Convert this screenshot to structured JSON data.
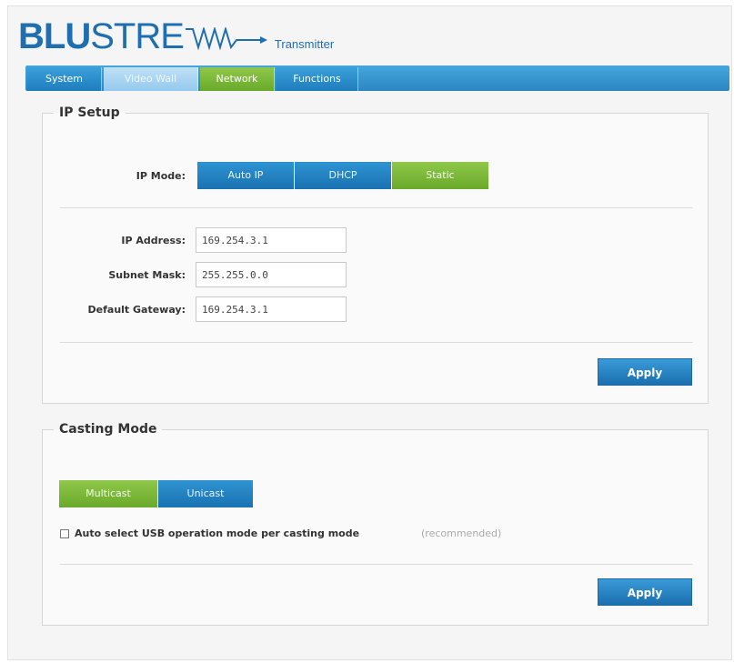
{
  "header": {
    "logo_blu": "BLU",
    "logo_stre": "STRE",
    "subtitle": "Transmitter",
    "brand_color": "#1f6fb0"
  },
  "tabs": [
    {
      "label": "System"
    },
    {
      "label": "Video Wall"
    },
    {
      "label": "Network",
      "active": true
    },
    {
      "label": "Functions"
    }
  ],
  "ip_setup": {
    "title": "IP Setup",
    "mode_label": "IP Mode:",
    "modes": [
      "Auto IP",
      "DHCP",
      "Static"
    ],
    "selected_mode": "Static",
    "ip_address_label": "IP Address:",
    "ip_address": "169.254.3.1",
    "subnet_mask_label": "Subnet Mask:",
    "subnet_mask": "255.255.0.0",
    "gateway_label": "Default Gateway:",
    "gateway": "169.254.3.1",
    "apply_label": "Apply"
  },
  "casting_mode": {
    "title": "Casting Mode",
    "options": [
      "Multicast",
      "Unicast"
    ],
    "selected": "Multicast",
    "usb_checkbox_label": "Auto select USB operation mode per casting mode",
    "usb_checkbox_note": "(recommended)",
    "usb_checked": false,
    "apply_label": "Apply"
  },
  "colors": {
    "accent_blue": "#1f7dbd",
    "selected_green": "#7ab83a"
  }
}
